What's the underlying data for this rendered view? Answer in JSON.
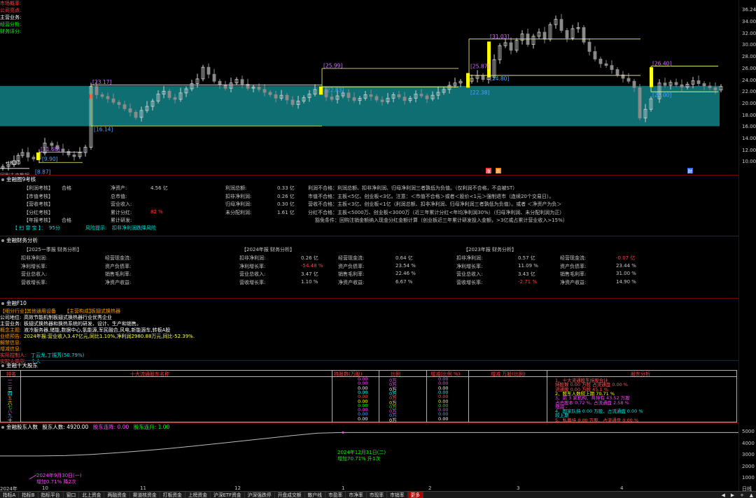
{
  "chart": {
    "top_labels": [
      "市场概率:",
      "公司亮点:",
      "主营业务:",
      "经营分析:",
      "财务评分:"
    ],
    "price_top": "36.24",
    "y_ticks": [
      "34.00",
      "32.00",
      "30.00",
      "28.00",
      "26.00",
      "24.00",
      "22.00",
      "20.00",
      "18.00",
      "16.00",
      "14.00",
      "12.00",
      "10.00"
    ],
    "annotations": [
      "[23.17]",
      "[16.14]",
      "[11.68]",
      "[9.90]",
      "[8.87]",
      "[25.99]",
      "[22.83]",
      "[25.87]",
      "[31.03]",
      "[24.80]",
      "[22.38]",
      "[26.40]",
      "[22.00]"
    ],
    "left_bottom_note": "回到未来数据",
    "low_price": "8.30",
    "badges": [
      "涨",
      "跌",
      "财"
    ],
    "colors": {
      "band": "#0f6e72",
      "up": "#ff2a2a",
      "down": "#00ffff",
      "signal": "#ffff00"
    }
  },
  "ninecheck": {
    "title": "金融圈9考核",
    "rows": [
      {
        "name": "【利润考核】",
        "result": "合格",
        "k1": "净资产:",
        "v1": "4.56 亿",
        "k2": "利润总额:",
        "v2": "0.33 亿",
        "note": "利润不合格：利润总额、扣非净利润、归母净利润三者孰低为负值。（仅利润不合格，不会被ST）"
      },
      {
        "name": "【市值考核】",
        "result": "",
        "k1": "总市值:",
        "v1": "",
        "k2": "扣非净利润:",
        "v2": "0.26 亿",
        "note": "市值不合格：主板<5亿、创业板<3亿。注意：＜市值不合格＞或者＜股价<1元＞强制退市（连续20个交易日）。"
      },
      {
        "name": "【营收考核】",
        "result": "",
        "k1": "营业收入:",
        "v1": "",
        "k2": "归母净利润:",
        "v2": "0.30 亿",
        "note": "营收不合格：主板<3亿、创业板<1亿（利润总额、扣非净利润、归母净利润三者孰低为负值）。或者 ＜净资产为负＞"
      },
      {
        "name": "【分红考核】",
        "result": "",
        "k1": "累计分红:",
        "v1": "82 %",
        "k2": "未分配利润:",
        "v2": "1.61 亿",
        "note": "分红不合格：主板<5000万、创业板<3000万（近三年累计分红<年均净利润30%）（归母净利润、未分配利润为正）"
      },
      {
        "name": "【年报考核】",
        "result": "合格",
        "k1": "累计研发:",
        "v1": "",
        "k2": "",
        "v2": "",
        "note": "豁免条件：回购注销金额纳入现金分红金额计算（创业板近三年累计研发投入金额，>3亿或占累计营业收入>15%）"
      }
    ],
    "score_label": "【 扫 雷 宝 】：",
    "score_value": "95分",
    "risk_label": "风险提示:",
    "risk_value": "扣非净利润跌降风险"
  },
  "finance": {
    "title": "金融财务分析",
    "columns": [
      {
        "header": "【2025一季报  财务分析】",
        "rows": [
          [
            "扣非净利润:",
            ""
          ],
          [
            "净利增长率:",
            ""
          ],
          [
            "营业总收入:",
            ""
          ],
          [
            "营收增长率:",
            ""
          ]
        ],
        "rows2": [
          [
            "经营现金流:",
            ""
          ],
          [
            "资产负债率:",
            ""
          ],
          [
            "销售毛利率:",
            ""
          ],
          [
            "净资产收益:",
            ""
          ]
        ]
      },
      {
        "header": "【2024年报  财务分析】",
        "rows": [
          [
            "扣非净利润:",
            "0.26 亿"
          ],
          [
            "净利增长率:",
            "-54.48 %"
          ],
          [
            "营业总收入:",
            "3.47 亿"
          ],
          [
            "营收增长率:",
            "1.10 %"
          ]
        ],
        "rows2": [
          [
            "经营现金流:",
            "0.64 亿"
          ],
          [
            "资产负债率:",
            "23.54 %"
          ],
          [
            "销售毛利率:",
            "22.46 %"
          ],
          [
            "净资产收益:",
            "6.67 %"
          ]
        ]
      },
      {
        "header": "【2023年报  财务分析】",
        "rows": [
          [
            "扣非净利润:",
            "0.57 亿"
          ],
          [
            "净利增长率:",
            "11.09 %"
          ],
          [
            "营业总收入:",
            "3.43 亿"
          ],
          [
            "营收增长率:",
            "-2.71 %"
          ]
        ],
        "rows2": [
          [
            "经营现金流:",
            "-0.07 亿"
          ],
          [
            "资产负债率:",
            "23.44 %"
          ],
          [
            "销售毛利率:",
            "31.00 %"
          ],
          [
            "净资产收益:",
            "14.90 %"
          ]
        ]
      }
    ]
  },
  "f10": {
    "title": "金融F10",
    "industry_label": "【细分行业】",
    "industry_value": "其他通用设备",
    "structure_label": "【主营构成】",
    "structure_value": "板翅式换热器",
    "lines": [
      {
        "k": "公司地位:",
        "v": "高效节能机制板翅式换热器行业优秀企业"
      },
      {
        "k": "主营业务:",
        "v": "板翅式换热器和换热系统的研发、设计、生产和销售。"
      },
      {
        "k": "概念主题:",
        "v": "液冷服务器,储能,数据中心,氢能源,军民融合,风电,新能源车,转板A股"
      },
      {
        "k": "业绩预告:",
        "v": "2024年报:营业收入3.47亿元,同比1.10%,净利润2980.88万元,同比-52.39%."
      },
      {
        "k": "解禁信息:",
        "v": ""
      },
      {
        "k": "增减信息:",
        "v": ""
      },
      {
        "k": "实际控制人:",
        "v": "丁云龙,丁振芳(50.79%)"
      },
      {
        "k": "实控人类型:",
        "v": "个人"
      }
    ]
  },
  "shareholders": {
    "title": "金融十大股东",
    "headers": [
      "排名",
      "十大流通股东名称",
      "持股数(万股)",
      "比例",
      "增减(比例 %)",
      "增减 万股(比例)",
      "股东分析"
    ],
    "ranks": [
      "一",
      "二",
      "三",
      "四",
      "五",
      "六",
      "七",
      "八",
      "九",
      "十"
    ],
    "shares": [
      "0.00",
      "0.00",
      "0.00",
      "0.00",
      "0.00",
      "0.00",
      "0.00",
      "0.00",
      "0.00",
      "0.00"
    ],
    "ratios": [
      "0万",
      "0万",
      "0万",
      "0万",
      "0万",
      "0万",
      "0万",
      "0万",
      "0万",
      "0万"
    ],
    "changes": [
      "0.00",
      "0.00",
      "0.00",
      "0.00",
      "0.00",
      "0.00",
      "0.00",
      "0.00",
      "0.00",
      "0.00"
    ],
    "analysis": [
      {
        "text": "1、十大流通股东持股合计",
        "cls": "pink"
      },
      {
        "text": "持股数 0.00 万股  占流通盘 0.00 %",
        "cls": "pink"
      },
      {
        "text": "流通股 0.00 万股  45.1 %",
        "cls": "pink"
      },
      {
        "text": "2、股东人数较上期 70.71 %",
        "cls": "yellow"
      },
      {
        "text": "3、前 3 家机构、共持有 43.52 万股",
        "cls": "magenta"
      },
      {
        "text": "占总股本 0.72 %, 占流通盘 2.58 %",
        "cls": "magenta"
      },
      {
        "text": "增减 -",
        "cls": "magenta"
      },
      {
        "text": "4、国家队持 0.00 万股、占流通盘 0.00 %",
        "cls": "cyan"
      },
      {
        "text": "较上期",
        "cls": "cyan"
      },
      {
        "text": "5、私募持 0.00 万股、占流通盘 0.00 %",
        "cls": "pink"
      }
    ]
  },
  "holders": {
    "title": "金融股东人数",
    "count_label": "股东人数: 4920.00",
    "cont_down": "股东连降: 0.00",
    "cont_up": "股东连升: 1.00",
    "y_ticks": [
      "5000",
      "4000",
      "3000",
      "2000",
      "1000"
    ],
    "marker1_date": "2024年12月31日(二)",
    "marker1_change": "增加70.71%  升1次",
    "marker2_date": "2024年9月30日(一)",
    "marker2_change": "增加0.71%  降2次",
    "series": [
      2883,
      2890,
      2920,
      3010,
      3150,
      3320,
      3510,
      3720,
      3950,
      4180,
      4420,
      4650,
      4860,
      4920
    ]
  },
  "xaxis": {
    "labels": [
      "2024年",
      "10",
      "11",
      "12",
      "1",
      "2",
      "3",
      "4"
    ],
    "right_label": "日线"
  },
  "tabs": [
    {
      "label": "指标A",
      "active": false
    },
    {
      "label": "指标B",
      "active": false
    },
    {
      "label": "指标平台",
      "active": false
    },
    {
      "label": "窗口",
      "active": false
    },
    {
      "label": "北上资金",
      "active": false
    },
    {
      "label": "两融资金",
      "active": false
    },
    {
      "label": "渠道核资金",
      "active": false
    },
    {
      "label": "打板资金",
      "active": false
    },
    {
      "label": "上榜资金",
      "active": false
    },
    {
      "label": "沪深ETF资金",
      "active": false
    },
    {
      "label": "沪深强跌停",
      "active": false
    },
    {
      "label": "开盘成交额",
      "active": false
    },
    {
      "label": "散户线",
      "active": false
    },
    {
      "label": "市盈率",
      "active": false
    },
    {
      "label": "市净率",
      "active": false
    },
    {
      "label": "市现率",
      "active": false
    },
    {
      "label": "市销率",
      "active": false
    },
    {
      "label": "更多",
      "active": true
    }
  ],
  "tabbar_right": [
    "◀",
    "▶",
    "+",
    "▲"
  ]
}
